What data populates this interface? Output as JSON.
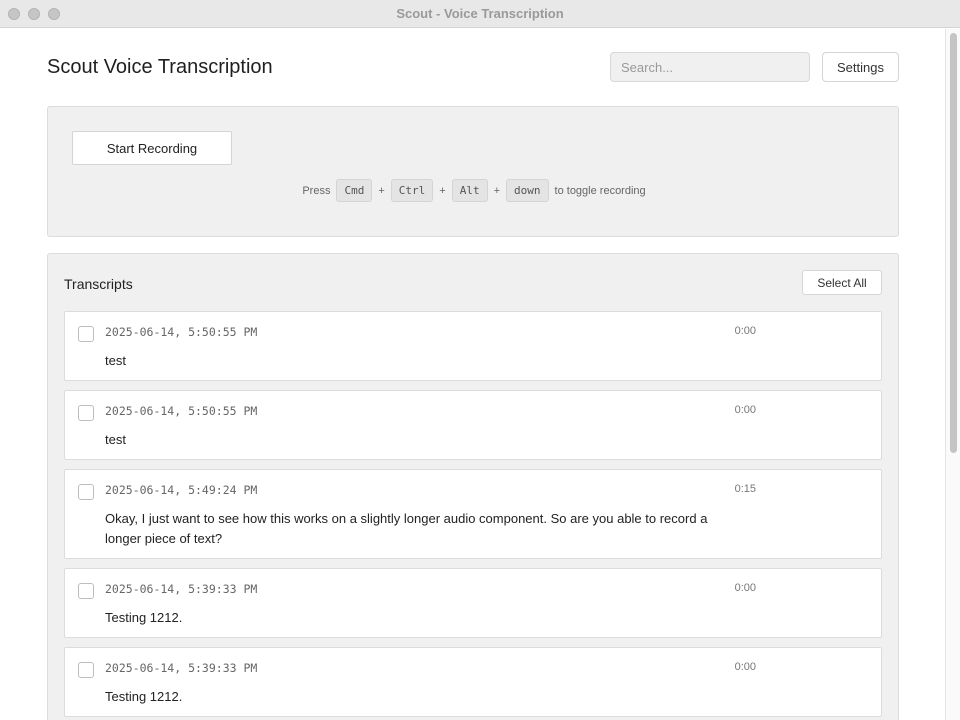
{
  "window": {
    "title": "Scout - Voice Transcription"
  },
  "header": {
    "title": "Scout Voice Transcription",
    "search_placeholder": "Search...",
    "settings_label": "Settings"
  },
  "recorder": {
    "start_label": "Start Recording",
    "hint_prefix": "Press",
    "keys": [
      "Cmd",
      "Ctrl",
      "Alt",
      "down"
    ],
    "separator": "+",
    "hint_suffix": "to toggle recording"
  },
  "transcripts": {
    "heading": "Transcripts",
    "select_all_label": "Select All",
    "items": [
      {
        "timestamp": "2025-06-14, 5:50:55 PM",
        "duration": "0:00",
        "text": "test"
      },
      {
        "timestamp": "2025-06-14, 5:50:55 PM",
        "duration": "0:00",
        "text": "test"
      },
      {
        "timestamp": "2025-06-14, 5:49:24 PM",
        "duration": "0:15",
        "text": "Okay, I just want to see how this works on a slightly longer audio component. So are you able to record a longer piece of text?"
      },
      {
        "timestamp": "2025-06-14, 5:39:33 PM",
        "duration": "0:00",
        "text": "Testing 1212."
      },
      {
        "timestamp": "2025-06-14, 5:39:33 PM",
        "duration": "0:00",
        "text": "Testing 1212."
      }
    ]
  }
}
